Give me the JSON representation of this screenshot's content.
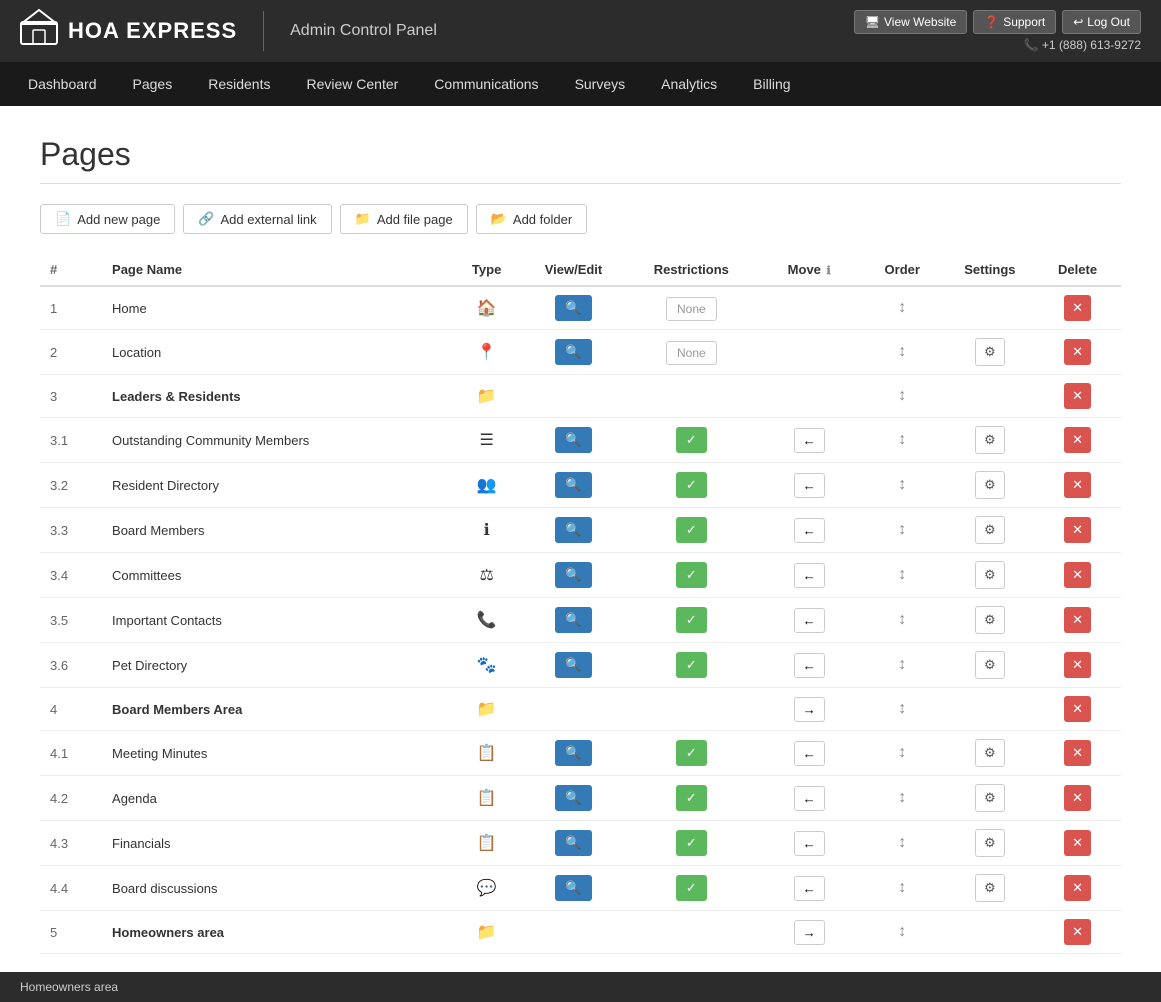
{
  "header": {
    "logo_text": "HOA EXPRESS",
    "admin_panel_label": "Admin Control Panel",
    "view_website_btn": "View Website",
    "support_btn": "Support",
    "logout_btn": "Log Out",
    "phone": "+1 (888) 613-9272"
  },
  "navbar": {
    "items": [
      {
        "label": "Dashboard",
        "href": "#"
      },
      {
        "label": "Pages",
        "href": "#"
      },
      {
        "label": "Residents",
        "href": "#"
      },
      {
        "label": "Review Center",
        "href": "#"
      },
      {
        "label": "Communications",
        "href": "#"
      },
      {
        "label": "Surveys",
        "href": "#"
      },
      {
        "label": "Analytics",
        "href": "#"
      },
      {
        "label": "Billing",
        "href": "#"
      }
    ]
  },
  "page_title": "Pages",
  "action_buttons": [
    {
      "label": "Add new page",
      "icon": "📄"
    },
    {
      "label": "Add external link",
      "icon": "🔗"
    },
    {
      "label": "Add file page",
      "icon": "📁"
    },
    {
      "label": "Add folder",
      "icon": "📂"
    }
  ],
  "table": {
    "columns": [
      "#",
      "Page Name",
      "Type",
      "View/Edit",
      "Restrictions",
      "Move",
      "Order",
      "Settings",
      "Delete"
    ],
    "rows": [
      {
        "num": "1",
        "name": "Home",
        "bold": false,
        "type_icon": "🏠",
        "has_view": true,
        "has_restrict": true,
        "restrict_val": "None",
        "has_move_left": false,
        "has_move_right": false,
        "has_order": true,
        "has_settings": false,
        "has_delete": true
      },
      {
        "num": "2",
        "name": "Location",
        "bold": false,
        "type_icon": "📍",
        "has_view": true,
        "has_restrict": true,
        "restrict_val": "None",
        "has_move_left": false,
        "has_move_right": false,
        "has_order": true,
        "has_settings": true,
        "has_delete": true
      },
      {
        "num": "3",
        "name": "Leaders & Residents",
        "bold": true,
        "type_icon": "📁",
        "has_view": false,
        "has_restrict": false,
        "restrict_val": "",
        "has_move_left": false,
        "has_move_right": false,
        "has_order": true,
        "has_settings": false,
        "has_delete": true
      },
      {
        "num": "3.1",
        "name": "Outstanding Community Members",
        "bold": false,
        "type_icon": "☰",
        "has_view": true,
        "has_restrict": true,
        "restrict_val": "green",
        "has_move_left": true,
        "has_move_right": false,
        "has_order": true,
        "has_settings": true,
        "has_delete": true
      },
      {
        "num": "3.2",
        "name": "Resident Directory",
        "bold": false,
        "type_icon": "👥",
        "has_view": true,
        "has_restrict": true,
        "restrict_val": "green",
        "has_move_left": true,
        "has_move_right": false,
        "has_order": true,
        "has_settings": true,
        "has_delete": true
      },
      {
        "num": "3.3",
        "name": "Board Members",
        "bold": false,
        "type_icon": "ℹ",
        "has_view": true,
        "has_restrict": true,
        "restrict_val": "green",
        "has_move_left": true,
        "has_move_right": false,
        "has_order": true,
        "has_settings": true,
        "has_delete": true
      },
      {
        "num": "3.4",
        "name": "Committees",
        "bold": false,
        "type_icon": "⚖",
        "has_view": true,
        "has_restrict": true,
        "restrict_val": "green",
        "has_move_left": true,
        "has_move_right": false,
        "has_order": true,
        "has_settings": true,
        "has_delete": true
      },
      {
        "num": "3.5",
        "name": "Important Contacts",
        "bold": false,
        "type_icon": "📞",
        "has_view": true,
        "has_restrict": true,
        "restrict_val": "green",
        "has_move_left": true,
        "has_move_right": false,
        "has_order": true,
        "has_settings": true,
        "has_delete": true
      },
      {
        "num": "3.6",
        "name": "Pet Directory",
        "bold": false,
        "type_icon": "🐾",
        "has_view": true,
        "has_restrict": true,
        "restrict_val": "green",
        "has_move_left": true,
        "has_move_right": false,
        "has_order": true,
        "has_settings": true,
        "has_delete": true
      },
      {
        "num": "4",
        "name": "Board Members Area",
        "bold": true,
        "type_icon": "📁",
        "has_view": false,
        "has_restrict": false,
        "restrict_val": "",
        "has_move_left": false,
        "has_move_right": true,
        "has_order": true,
        "has_settings": false,
        "has_delete": true
      },
      {
        "num": "4.1",
        "name": "Meeting Minutes",
        "bold": false,
        "type_icon": "📋",
        "has_view": true,
        "has_restrict": true,
        "restrict_val": "green",
        "has_move_left": true,
        "has_move_right": false,
        "has_order": true,
        "has_settings": true,
        "has_delete": true
      },
      {
        "num": "4.2",
        "name": "Agenda",
        "bold": false,
        "type_icon": "📋",
        "has_view": true,
        "has_restrict": true,
        "restrict_val": "green",
        "has_move_left": true,
        "has_move_right": false,
        "has_order": true,
        "has_settings": true,
        "has_delete": true
      },
      {
        "num": "4.3",
        "name": "Financials",
        "bold": false,
        "type_icon": "📋",
        "has_view": true,
        "has_restrict": true,
        "restrict_val": "green",
        "has_move_left": true,
        "has_move_right": false,
        "has_order": true,
        "has_settings": true,
        "has_delete": true
      },
      {
        "num": "4.4",
        "name": "Board discussions",
        "bold": false,
        "type_icon": "💬",
        "has_view": true,
        "has_restrict": true,
        "restrict_val": "green",
        "has_move_left": true,
        "has_move_right": false,
        "has_order": true,
        "has_settings": true,
        "has_delete": true
      },
      {
        "num": "5",
        "name": "Homeowners area",
        "bold": true,
        "type_icon": "📁",
        "has_view": false,
        "has_restrict": false,
        "restrict_val": "",
        "has_move_left": false,
        "has_move_right": true,
        "has_order": true,
        "has_settings": false,
        "has_delete": true
      }
    ]
  },
  "footer": {
    "link_text": "Homeowners area"
  }
}
